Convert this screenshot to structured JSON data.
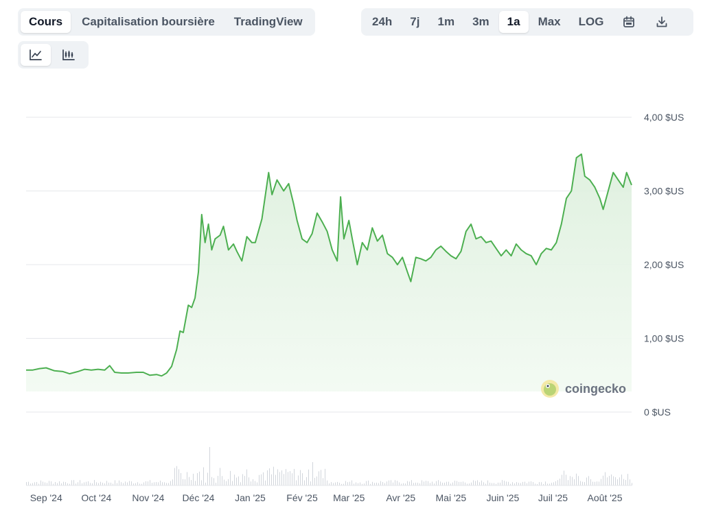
{
  "tabs": [
    {
      "label": "Cours",
      "active": true
    },
    {
      "label": "Capitalisation boursière",
      "active": false
    },
    {
      "label": "TradingView",
      "active": false
    }
  ],
  "ranges": [
    {
      "label": "24h",
      "active": false
    },
    {
      "label": "7j",
      "active": false
    },
    {
      "label": "1m",
      "active": false
    },
    {
      "label": "3m",
      "active": false
    },
    {
      "label": "1a",
      "active": true
    },
    {
      "label": "Max",
      "active": false
    },
    {
      "label": "LOG",
      "active": false
    }
  ],
  "icons": {
    "calendar": "calendar-icon",
    "download": "download-icon",
    "line_chart": "line-chart-icon",
    "candlestick": "candlestick-icon"
  },
  "watermark": "coingecko",
  "colors": {
    "line": "#4caf50",
    "fill": "#e8f5e9",
    "grid": "#e5e7eb",
    "volume": "#d1d5db"
  },
  "chart_data": {
    "type": "area",
    "y_tick_labels": [
      "0 $US",
      "1,00 $US",
      "2,00 $US",
      "3,00 $US",
      "4,00 $US"
    ],
    "y_ticks": [
      0,
      1,
      2,
      3,
      4
    ],
    "ylim": [
      0,
      4
    ],
    "x_tick_labels": [
      "Sep '24",
      "Oct '24",
      "Nov '24",
      "Déc '24",
      "Jan '25",
      "Fév '25",
      "Mar '25",
      "Avr '25",
      "Mai '25",
      "Juin '25",
      "Juil '25",
      "Août '25"
    ],
    "x_tick_dates": [
      "2024-09-01",
      "2024-10-01",
      "2024-11-01",
      "2024-12-01",
      "2025-01-01",
      "2025-02-01",
      "2025-03-01",
      "2025-04-01",
      "2025-05-01",
      "2025-06-01",
      "2025-07-01",
      "2025-08-01"
    ],
    "x_range": [
      "2024-08-20",
      "2025-08-17"
    ],
    "grid": true,
    "series": [
      {
        "points": [
          [
            "2024-08-20",
            0.57
          ],
          [
            "2024-08-24",
            0.57
          ],
          [
            "2024-08-28",
            0.59
          ],
          [
            "2024-09-01",
            0.6
          ],
          [
            "2024-09-06",
            0.56
          ],
          [
            "2024-09-11",
            0.55
          ],
          [
            "2024-09-15",
            0.52
          ],
          [
            "2024-09-20",
            0.55
          ],
          [
            "2024-09-24",
            0.58
          ],
          [
            "2024-09-28",
            0.57
          ],
          [
            "2024-10-02",
            0.58
          ],
          [
            "2024-10-06",
            0.57
          ],
          [
            "2024-10-09",
            0.63
          ],
          [
            "2024-10-12",
            0.54
          ],
          [
            "2024-10-16",
            0.53
          ],
          [
            "2024-10-20",
            0.53
          ],
          [
            "2024-10-25",
            0.54
          ],
          [
            "2024-10-29",
            0.54
          ],
          [
            "2024-11-02",
            0.5
          ],
          [
            "2024-11-06",
            0.51
          ],
          [
            "2024-11-09",
            0.49
          ],
          [
            "2024-11-12",
            0.53
          ],
          [
            "2024-11-15",
            0.62
          ],
          [
            "2024-11-18",
            0.85
          ],
          [
            "2024-11-20",
            1.1
          ],
          [
            "2024-11-22",
            1.08
          ],
          [
            "2024-11-25",
            1.45
          ],
          [
            "2024-11-27",
            1.42
          ],
          [
            "2024-11-29",
            1.55
          ],
          [
            "2024-12-01",
            1.9
          ],
          [
            "2024-12-03",
            2.68
          ],
          [
            "2024-12-05",
            2.3
          ],
          [
            "2024-12-07",
            2.55
          ],
          [
            "2024-12-09",
            2.2
          ],
          [
            "2024-12-11",
            2.35
          ],
          [
            "2024-12-14",
            2.4
          ],
          [
            "2024-12-16",
            2.52
          ],
          [
            "2024-12-19",
            2.2
          ],
          [
            "2024-12-22",
            2.28
          ],
          [
            "2024-12-24",
            2.18
          ],
          [
            "2024-12-27",
            2.05
          ],
          [
            "2024-12-30",
            2.38
          ],
          [
            "2025-01-02",
            2.3
          ],
          [
            "2025-01-04",
            2.3
          ],
          [
            "2025-01-08",
            2.62
          ],
          [
            "2025-01-12",
            3.25
          ],
          [
            "2025-01-14",
            2.95
          ],
          [
            "2025-01-17",
            3.15
          ],
          [
            "2025-01-21",
            3.0
          ],
          [
            "2025-01-24",
            3.1
          ],
          [
            "2025-01-27",
            2.82
          ],
          [
            "2025-01-29",
            2.6
          ],
          [
            "2025-02-01",
            2.35
          ],
          [
            "2025-02-04",
            2.3
          ],
          [
            "2025-02-07",
            2.42
          ],
          [
            "2025-02-10",
            2.7
          ],
          [
            "2025-02-13",
            2.58
          ],
          [
            "2025-02-16",
            2.45
          ],
          [
            "2025-02-19",
            2.2
          ],
          [
            "2025-02-22",
            2.05
          ],
          [
            "2025-02-24",
            2.92
          ],
          [
            "2025-02-26",
            2.35
          ],
          [
            "2025-03-01",
            2.6
          ],
          [
            "2025-03-03",
            2.35
          ],
          [
            "2025-03-06",
            2.0
          ],
          [
            "2025-03-09",
            2.3
          ],
          [
            "2025-03-12",
            2.2
          ],
          [
            "2025-03-15",
            2.5
          ],
          [
            "2025-03-18",
            2.32
          ],
          [
            "2025-03-21",
            2.4
          ],
          [
            "2025-03-24",
            2.15
          ],
          [
            "2025-03-27",
            2.1
          ],
          [
            "2025-03-30",
            2.0
          ],
          [
            "2025-04-02",
            2.1
          ],
          [
            "2025-04-05",
            1.9
          ],
          [
            "2025-04-07",
            1.77
          ],
          [
            "2025-04-10",
            2.1
          ],
          [
            "2025-04-13",
            2.08
          ],
          [
            "2025-04-16",
            2.05
          ],
          [
            "2025-04-19",
            2.1
          ],
          [
            "2025-04-22",
            2.2
          ],
          [
            "2025-04-25",
            2.25
          ],
          [
            "2025-04-28",
            2.18
          ],
          [
            "2025-05-01",
            2.12
          ],
          [
            "2025-05-04",
            2.08
          ],
          [
            "2025-05-07",
            2.18
          ],
          [
            "2025-05-10",
            2.45
          ],
          [
            "2025-05-13",
            2.55
          ],
          [
            "2025-05-16",
            2.35
          ],
          [
            "2025-05-19",
            2.38
          ],
          [
            "2025-05-22",
            2.3
          ],
          [
            "2025-05-25",
            2.32
          ],
          [
            "2025-05-28",
            2.22
          ],
          [
            "2025-05-31",
            2.12
          ],
          [
            "2025-06-03",
            2.2
          ],
          [
            "2025-06-06",
            2.12
          ],
          [
            "2025-06-09",
            2.28
          ],
          [
            "2025-06-12",
            2.2
          ],
          [
            "2025-06-15",
            2.15
          ],
          [
            "2025-06-18",
            2.12
          ],
          [
            "2025-06-21",
            2.0
          ],
          [
            "2025-06-24",
            2.15
          ],
          [
            "2025-06-27",
            2.22
          ],
          [
            "2025-06-30",
            2.2
          ],
          [
            "2025-07-03",
            2.3
          ],
          [
            "2025-07-06",
            2.55
          ],
          [
            "2025-07-09",
            2.9
          ],
          [
            "2025-07-12",
            3.0
          ],
          [
            "2025-07-15",
            3.45
          ],
          [
            "2025-07-18",
            3.5
          ],
          [
            "2025-07-20",
            3.2
          ],
          [
            "2025-07-23",
            3.15
          ],
          [
            "2025-07-26",
            3.05
          ],
          [
            "2025-07-29",
            2.9
          ],
          [
            "2025-07-31",
            2.75
          ],
          [
            "2025-08-03",
            3.0
          ],
          [
            "2025-08-06",
            3.25
          ],
          [
            "2025-08-09",
            3.15
          ],
          [
            "2025-08-12",
            3.05
          ],
          [
            "2025-08-14",
            3.25
          ],
          [
            "2025-08-17",
            3.08
          ]
        ]
      }
    ]
  }
}
